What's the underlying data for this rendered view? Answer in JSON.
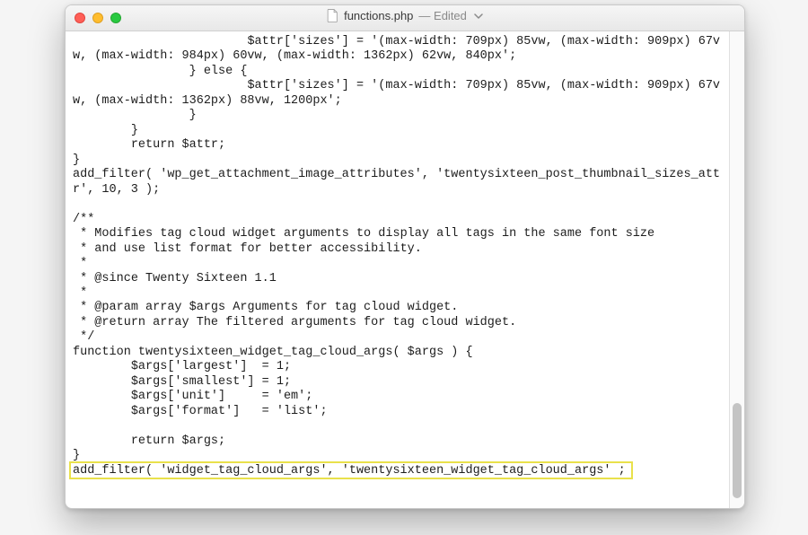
{
  "titlebar": {
    "filename": "functions.php",
    "status": "— Edited"
  },
  "scrollbar": {
    "thumb_top_pct": 78,
    "thumb_height_pct": 20
  },
  "highlight_line_index": 30,
  "code": {
    "lines": [
      "                        $attr['sizes'] = '(max-width: 709px) 85vw, (max-width: 909px) 67vw, (max-width: 984px) 60vw, (max-width: 1362px) 62vw, 840px';",
      "                } else {",
      "                        $attr['sizes'] = '(max-width: 709px) 85vw, (max-width: 909px) 67vw, (max-width: 1362px) 88vw, 1200px';",
      "                }",
      "        }",
      "        return $attr;",
      "}",
      "add_filter( 'wp_get_attachment_image_attributes', 'twentysixteen_post_thumbnail_sizes_attr', 10, 3 );",
      "",
      "/**",
      " * Modifies tag cloud widget arguments to display all tags in the same font size",
      " * and use list format for better accessibility.",
      " *",
      " * @since Twenty Sixteen 1.1",
      " *",
      " * @param array $args Arguments for tag cloud widget.",
      " * @return array The filtered arguments for tag cloud widget.",
      " */",
      "function twentysixteen_widget_tag_cloud_args( $args ) {",
      "        $args['largest']  = 1;",
      "        $args['smallest'] = 1;",
      "        $args['unit']     = 'em';",
      "        $args['format']   = 'list';",
      "",
      "        return $args;",
      "}",
      "add_filter( 'widget_tag_cloud_args', 'twentysixteen_widget_tag_cloud_args' ;"
    ]
  }
}
